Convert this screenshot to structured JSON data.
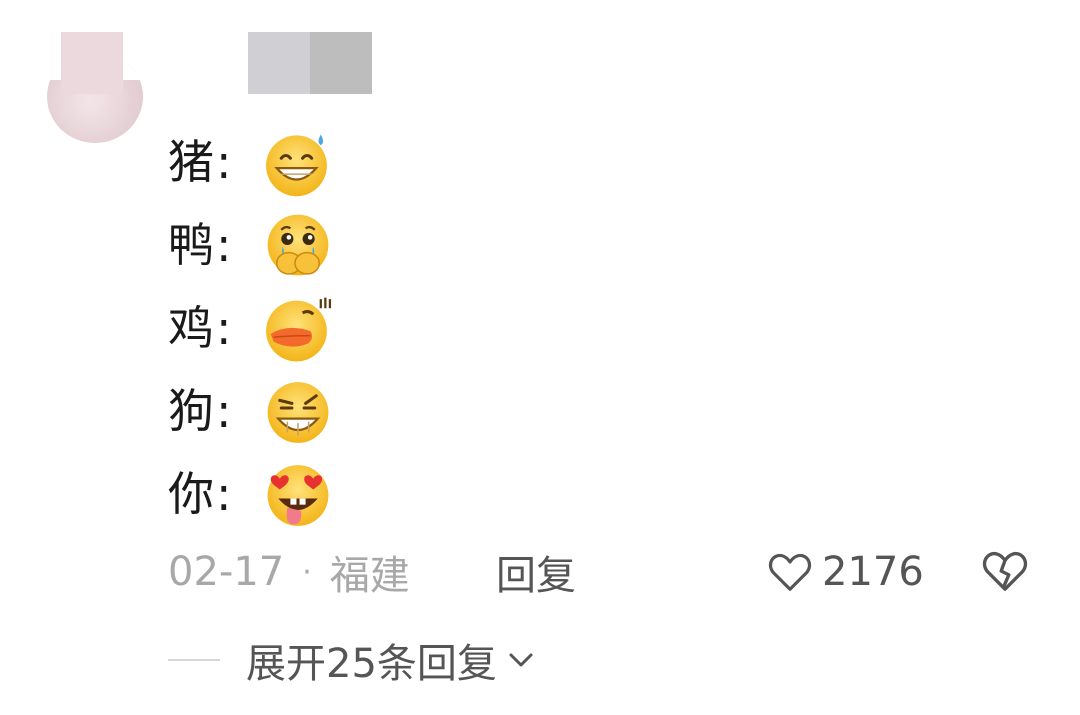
{
  "comment": {
    "lines": [
      {
        "label": "猪:",
        "emoji": "sweat-grin-emoji-icon"
      },
      {
        "label": "鸭:",
        "emoji": "crying-cover-mouth-emoji-icon"
      },
      {
        "label": "鸡:",
        "emoji": "duck-lips-emoji-icon"
      },
      {
        "label": "狗:",
        "emoji": "smirk-grin-emoji-icon"
      },
      {
        "label": "你:",
        "emoji": "heart-eyes-tongue-emoji-icon"
      }
    ],
    "date": "02-17",
    "separator": "·",
    "location": "福建",
    "reply_label": "回复",
    "like_count": "2176",
    "expand_label": "展开25条回复"
  },
  "colors": {
    "text": "#1a1a1a",
    "meta": "#a8a8a8",
    "action": "#555555",
    "emoji_face": "#f6c430"
  }
}
